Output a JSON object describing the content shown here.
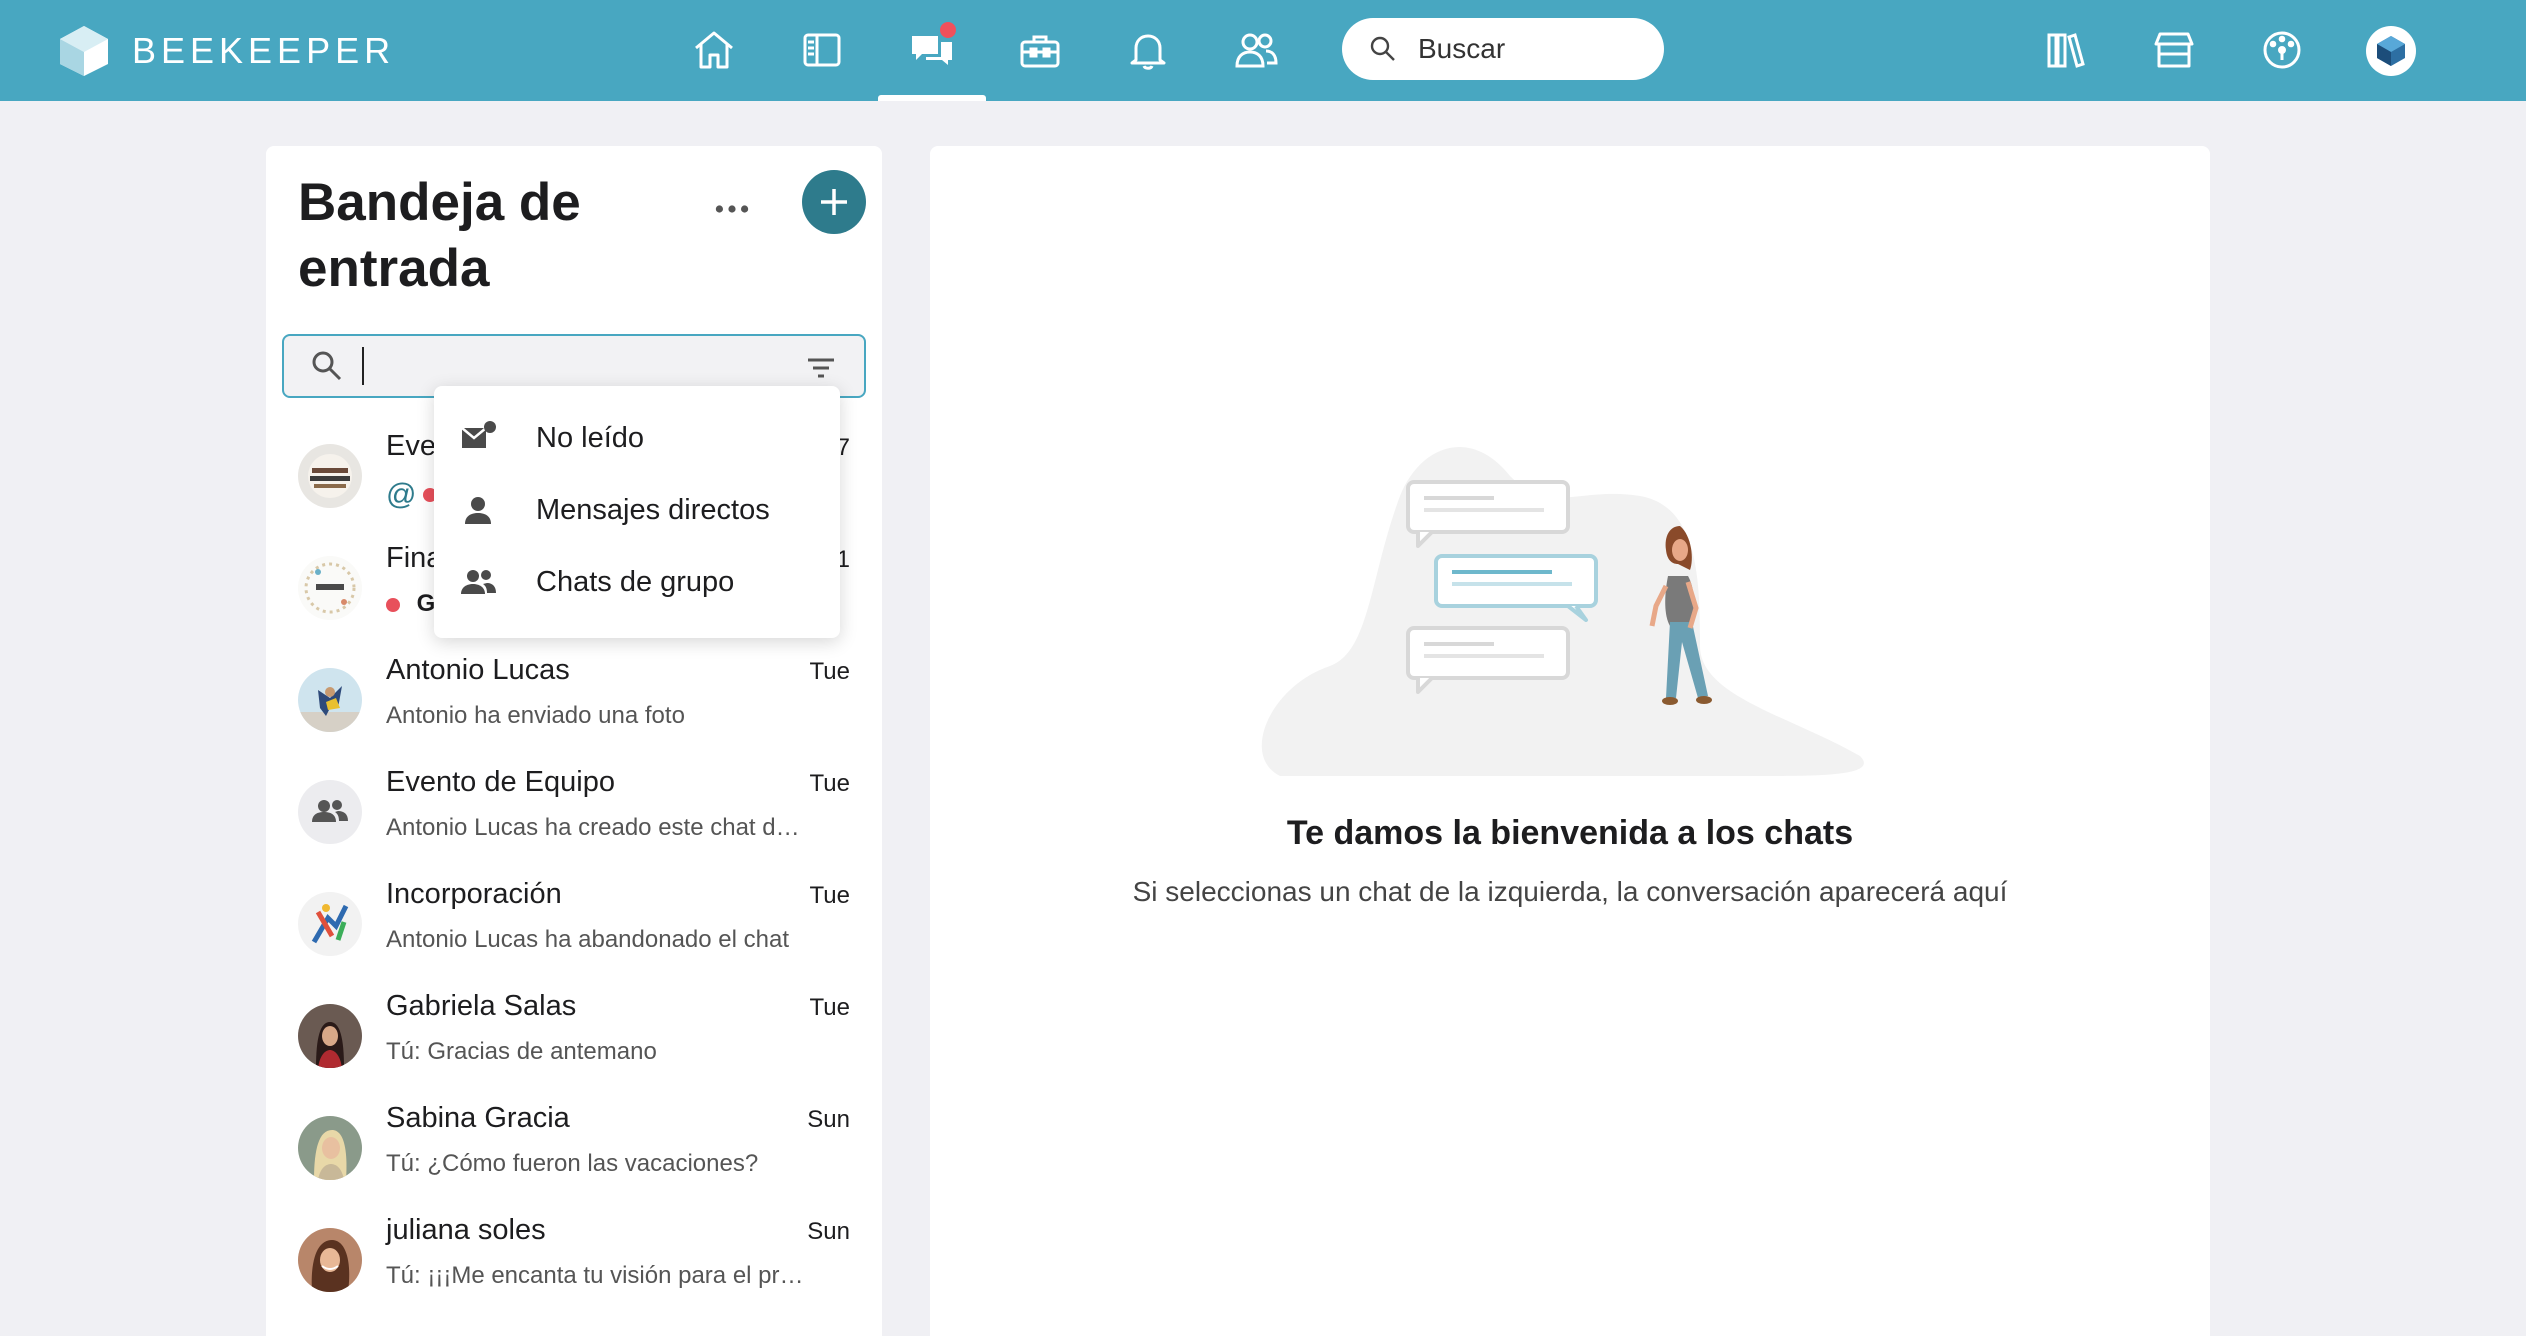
{
  "app": {
    "brand": "BEEKEEPER",
    "accent": "#48a7c1",
    "dark_accent": "#2e7b8c"
  },
  "topbar": {
    "nav": [
      {
        "name": "home",
        "icon": "home-icon"
      },
      {
        "name": "streams",
        "icon": "streams-icon"
      },
      {
        "name": "chats",
        "icon": "chat-bubbles-icon",
        "active": true,
        "badge": true
      },
      {
        "name": "tools",
        "icon": "toolbox-icon"
      },
      {
        "name": "notifications",
        "icon": "bell-icon"
      },
      {
        "name": "people",
        "icon": "people-icon"
      }
    ],
    "search_placeholder": "Buscar",
    "right_icons": [
      "library-icon",
      "store-icon",
      "dashboard-icon",
      "profile-avatar"
    ]
  },
  "inbox": {
    "title": "Bandeja de entrada",
    "search_value": "",
    "chats": [
      {
        "name": "Eve",
        "time": "7",
        "preview": "",
        "mention": "@",
        "unread": true
      },
      {
        "name": "Fina",
        "time": "1",
        "preview": "Ga",
        "unread": true
      },
      {
        "name": "Antonio Lucas",
        "time": "Tue",
        "preview": "Antonio ha enviado una foto"
      },
      {
        "name": "Evento de Equipo",
        "time": "Tue",
        "preview": "Antonio Lucas ha creado este chat d…"
      },
      {
        "name": "Incorporación",
        "time": "Tue",
        "preview": "Antonio Lucas ha abandonado el chat"
      },
      {
        "name": "Gabriela Salas",
        "time": "Tue",
        "preview": "Tú: Gracias de antemano"
      },
      {
        "name": "Sabina Gracia",
        "time": "Sun",
        "preview": "Tú: ¿Cómo fueron las vacaciones?"
      },
      {
        "name": "juliana soles",
        "time": "Sun",
        "preview": "Tú: ¡¡¡Me encanta tu visión para el pr…"
      }
    ]
  },
  "filter_menu": {
    "items": [
      {
        "label": "No leído",
        "icon": "unread-mail-icon"
      },
      {
        "label": "Mensajes directos",
        "icon": "person-icon"
      },
      {
        "label": "Chats de grupo",
        "icon": "group-icon"
      }
    ]
  },
  "main": {
    "welcome_title": "Te damos la bienvenida a los chats",
    "welcome_subtitle": "Si seleccionas un chat de la izquierda, la conversación aparecerá aquí"
  }
}
